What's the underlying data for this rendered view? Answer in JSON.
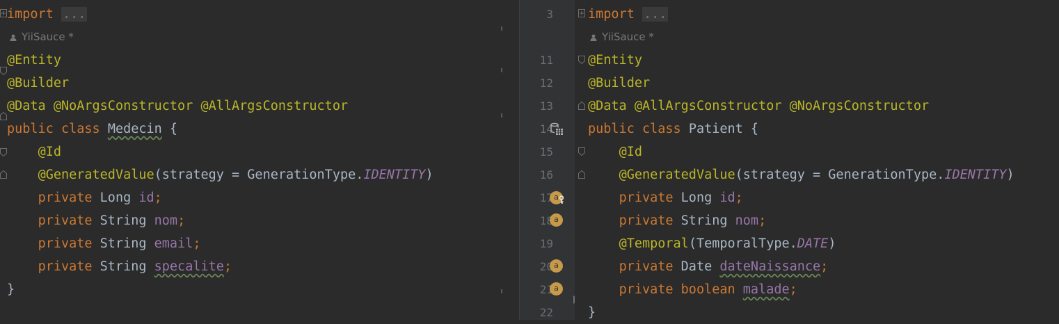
{
  "left_pane": {
    "import_kw": "import",
    "import_fold": "...",
    "author": "YiiSauce *",
    "lines": [
      {
        "ann": "@Entity"
      },
      {
        "ann": "@Builder"
      },
      {
        "ann1": "@Data",
        "ann2": "@NoArgsConstructor",
        "ann3": "@AllArgsConstructor"
      },
      {
        "kw1": "public",
        "kw2": "class",
        "name": "Medecin",
        "brace": "{"
      },
      {
        "ann": "@Id"
      },
      {
        "ann": "@GeneratedValue",
        "open": "(strategy = GenerationType.",
        "const": "IDENTITY",
        "close": ")"
      },
      {
        "kw": "private",
        "type": "Long",
        "field": "id",
        "semi": ";"
      },
      {
        "kw": "private",
        "type": "String",
        "field": "nom",
        "semi": ";"
      },
      {
        "kw": "private",
        "type": "String",
        "field": "email",
        "semi": ";"
      },
      {
        "kw": "private",
        "type": "String",
        "field": "specalite",
        "semi": ";"
      },
      {
        "brace": "}"
      }
    ]
  },
  "right_pane": {
    "import_kw": "import",
    "import_fold": "...",
    "author": "YiiSauce *",
    "lines": [
      {
        "ann": "@Entity"
      },
      {
        "ann": "@Builder"
      },
      {
        "ann1": "@Data",
        "ann2": "@AllArgsConstructor",
        "ann3": "@NoArgsConstructor"
      },
      {
        "kw1": "public",
        "kw2": "class",
        "name": "Patient",
        "brace": "{"
      },
      {
        "ann": "@Id"
      },
      {
        "ann": "@GeneratedValue",
        "open": "(strategy = GenerationType.",
        "const": "IDENTITY",
        "close": ")"
      },
      {
        "kw": "private",
        "type": "Long",
        "field": "id",
        "semi": ";"
      },
      {
        "kw": "private",
        "type": "String",
        "field": "nom",
        "semi": ";"
      },
      {
        "ann": "@Temporal",
        "open": "(TemporalType.",
        "const": "DATE",
        "close": ")"
      },
      {
        "kw": "private",
        "type": "Date",
        "field": "dateNaissance",
        "semi": ";"
      },
      {
        "kw": "private",
        "type": "boolean",
        "field": "malade",
        "semi": ";"
      },
      {
        "brace": "}"
      }
    ]
  },
  "gutter": {
    "line_numbers": [
      "3",
      "11",
      "12",
      "13",
      "14",
      "15",
      "16",
      "17",
      "18",
      "19",
      "20",
      "21",
      "22"
    ],
    "badge_label": "a",
    "icons": [
      "database-table-icon",
      "field-key-icon",
      "field-accessor-icon",
      "run-arrow-icon"
    ]
  }
}
